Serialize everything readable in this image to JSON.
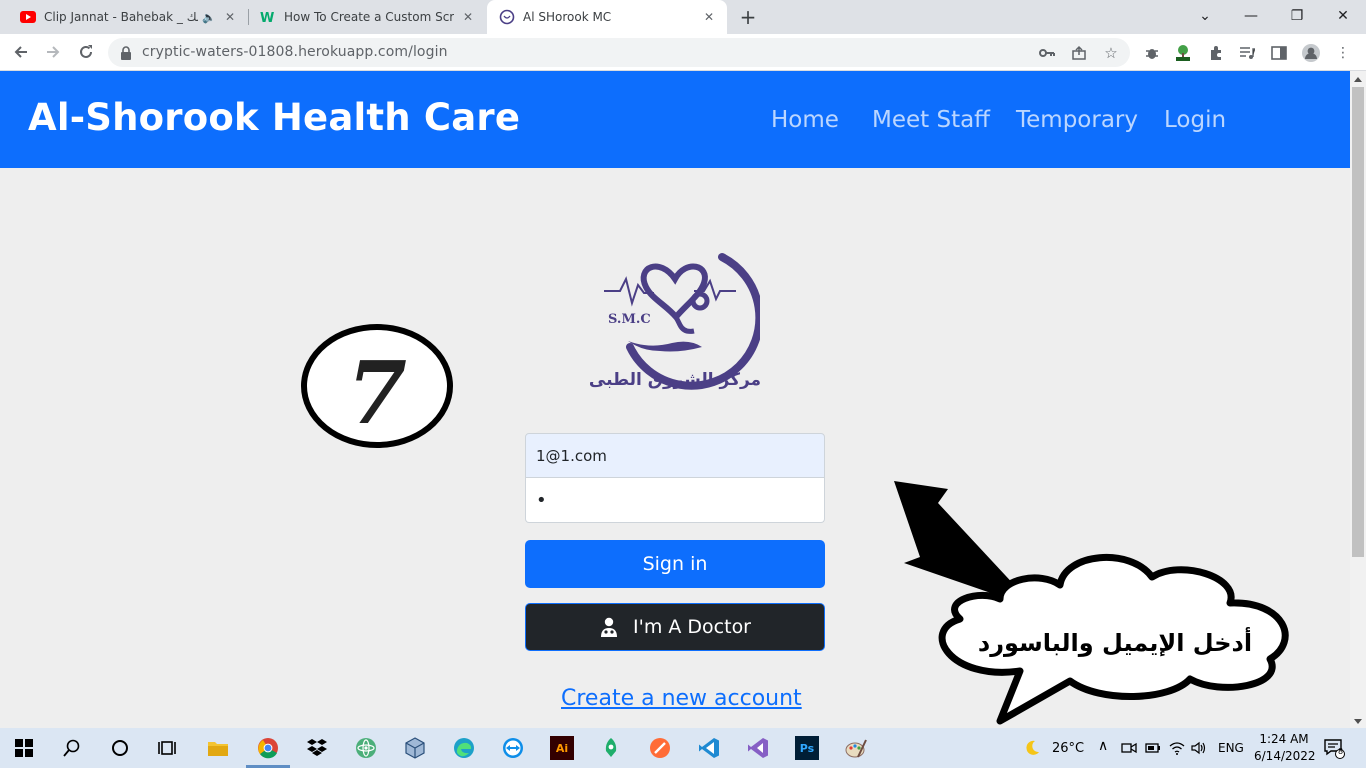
{
  "browser": {
    "tabs": [
      {
        "title": "Clip Jannat - Bahebak _ بحبك",
        "favicon": "youtube-icon",
        "audio": true,
        "active": false
      },
      {
        "title": "How To Create a Custom Scrollba",
        "favicon": "w-site-icon",
        "active": false
      },
      {
        "title": "Al SHorook MC",
        "favicon": "smc-logo-icon",
        "active": true
      }
    ],
    "new_tab": "+",
    "window_controls": {
      "dropdown": "⌄",
      "minimize": "—",
      "restore": "❐",
      "close": "✕"
    },
    "url": "cryptic-waters-01808.herokuapp.com/login"
  },
  "site": {
    "brand": "Al-Shorook Health Care",
    "nav": [
      "Home",
      "Meet Staff",
      "Temporary",
      "Login"
    ],
    "logo": {
      "initials": "S.M.C",
      "arabic_name": "مركز الشروق الطبى"
    },
    "login": {
      "email_value": "1@1.com",
      "password_value": "•",
      "signin_label": "Sign in",
      "doctor_label": "I'm A Doctor",
      "create_account_label": "Create a new account"
    }
  },
  "annotations": {
    "step_number": "7",
    "callout_text": "أدخل الإيميل والباسورد"
  },
  "taskbar": {
    "weather": "26°C",
    "language": "ENG",
    "time": "1:24 AM",
    "date": "6/14/2022",
    "notification_count": "8"
  },
  "colors": {
    "primary": "#0d6efd",
    "dark_button": "#212529",
    "page_background": "#eeeeee",
    "logo_purple": "#4b3f86"
  }
}
